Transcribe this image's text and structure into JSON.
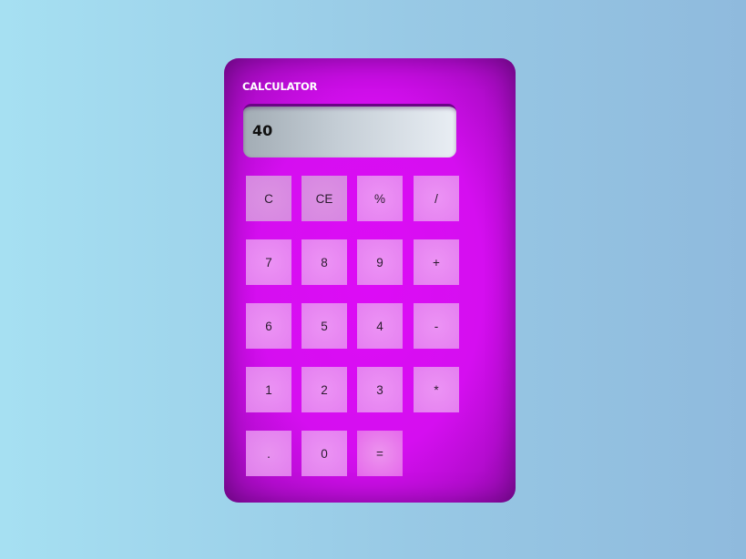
{
  "calculator": {
    "title": "CALCULATOR",
    "display_value": "40",
    "keys": {
      "clear": "C",
      "clear_entry": "CE",
      "percent": "%",
      "divide": "/",
      "seven": "7",
      "eight": "8",
      "nine": "9",
      "plus": "+",
      "six": "6",
      "five": "5",
      "four": "4",
      "minus": "-",
      "one": "1",
      "two": "2",
      "three": "3",
      "multiply": "*",
      "decimal": ".",
      "zero": "0",
      "equals": "="
    }
  },
  "colors": {
    "background_left": "#a6e0f2",
    "background_right": "#8fbadd",
    "body": "#dd0cf6",
    "body_edge": "#8a0aa2",
    "display": "#c5ced6",
    "key": "#e98cf0",
    "title_text": "#ffffff",
    "display_text": "#101010"
  }
}
